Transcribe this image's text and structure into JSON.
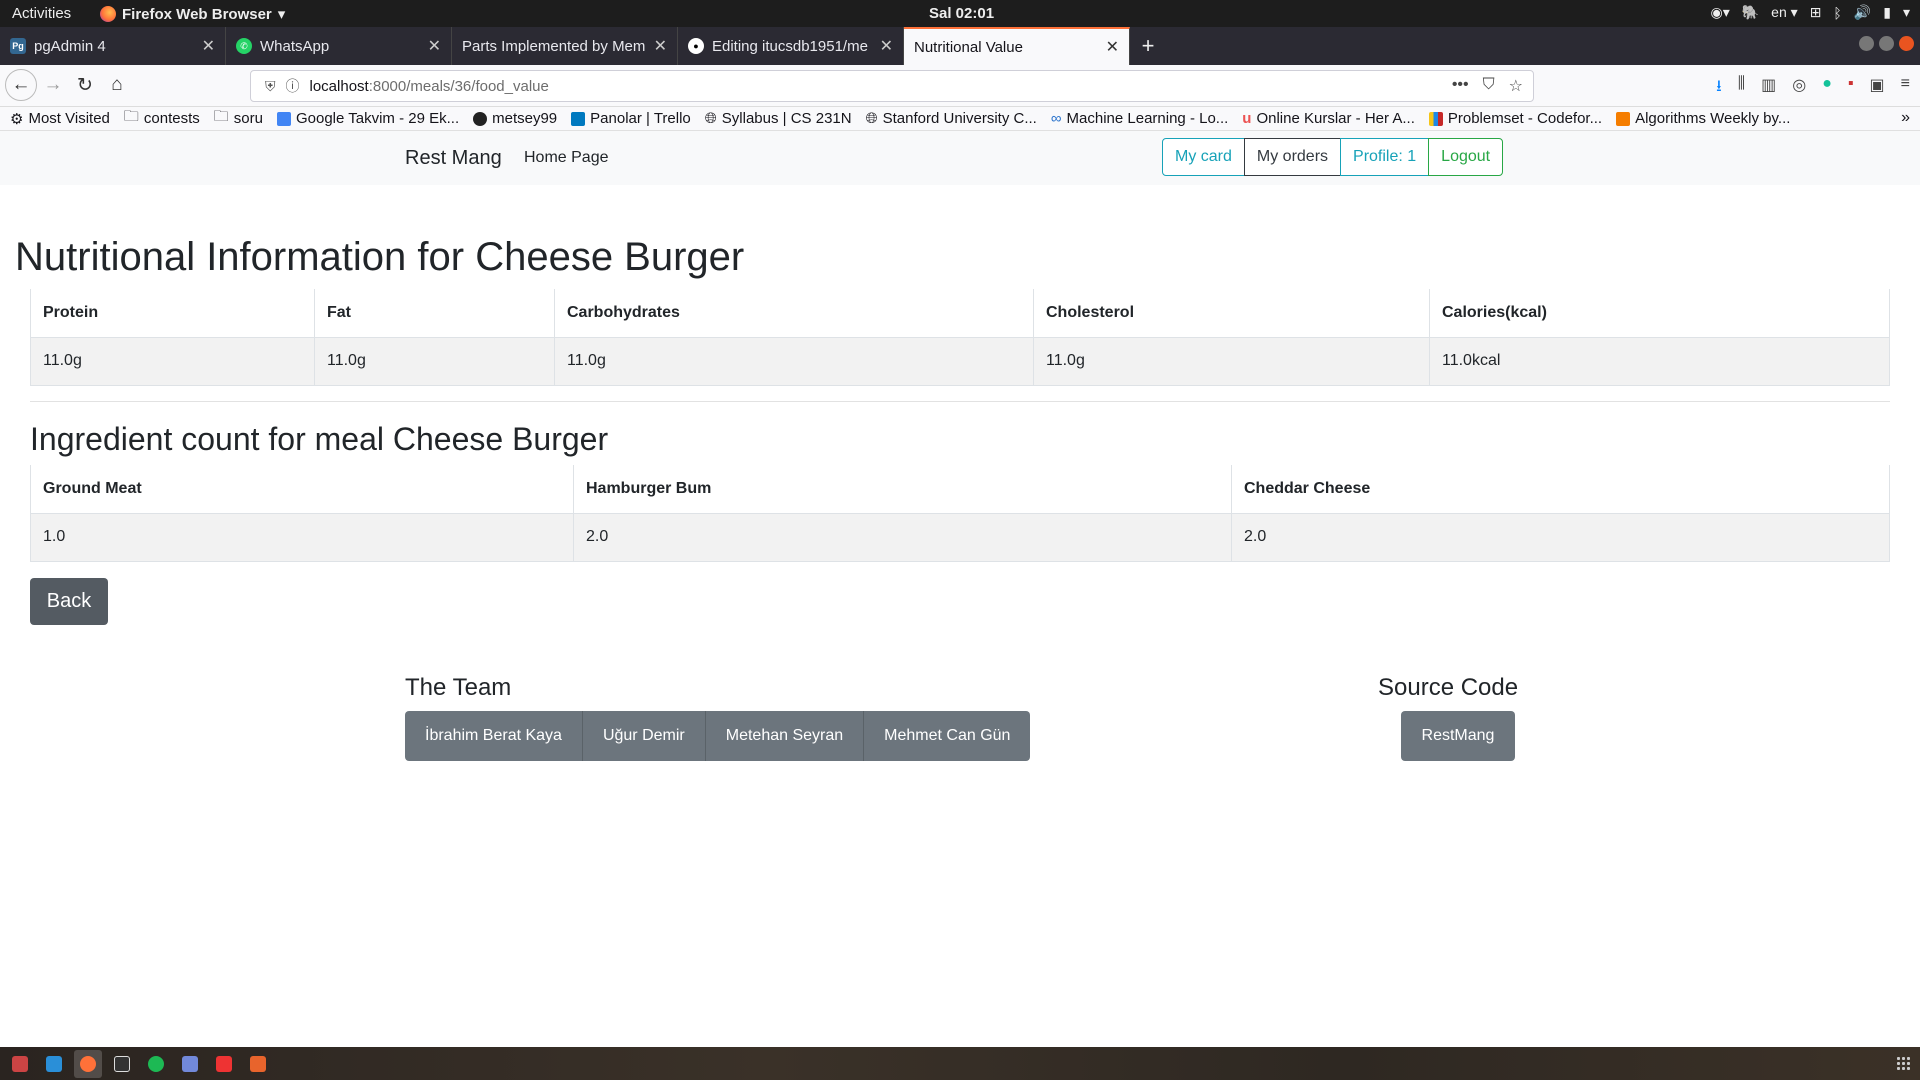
{
  "gnome": {
    "activities": "Activities",
    "app_name": "Firefox Web Browser",
    "clock": "Sal 02:01",
    "lang": "en"
  },
  "tabs": [
    {
      "title": "pgAdmin 4",
      "favicon": "pgadmin-icon",
      "favicon_text": "Pg",
      "color": "#336791"
    },
    {
      "title": "WhatsApp",
      "favicon": "whatsapp-icon",
      "favicon_text": "",
      "color": "#25d366"
    },
    {
      "title": "Parts Implemented by Mem",
      "favicon": "none",
      "favicon_text": "",
      "color": ""
    },
    {
      "title": "Editing itucsdb1951/me",
      "favicon": "github-icon",
      "favicon_text": "",
      "color": "#fff"
    },
    {
      "title": "Nutritional Value",
      "favicon": "none",
      "favicon_text": "",
      "color": "",
      "active": true
    }
  ],
  "url": {
    "host": "localhost",
    "path": ":8000/meals/36/food_value"
  },
  "bookmarks": [
    {
      "label": "Most Visited",
      "icon": "gear-icon",
      "color": "#555"
    },
    {
      "label": "contests",
      "icon": "folder-icon",
      "color": "#777"
    },
    {
      "label": "soru",
      "icon": "folder-icon",
      "color": "#777"
    },
    {
      "label": "Google Takvim - 29 Ek...",
      "icon": "calendar-icon",
      "color": "#4285f4"
    },
    {
      "label": "metsey99",
      "icon": "github-icon",
      "color": "#222"
    },
    {
      "label": "Panolar | Trello",
      "icon": "trello-icon",
      "color": "#0079bf"
    },
    {
      "label": "Syllabus | CS 231N",
      "icon": "globe-icon",
      "color": "#666"
    },
    {
      "label": "Stanford University C...",
      "icon": "globe-icon",
      "color": "#666"
    },
    {
      "label": "Machine Learning - Lo...",
      "icon": "coursera-icon",
      "color": "#2a73cc"
    },
    {
      "label": "Online Kurslar - Her A...",
      "icon": "udemy-icon",
      "color": "#ec5252"
    },
    {
      "label": "Problemset - Codefor...",
      "icon": "codeforces-icon",
      "color": "#f5c518"
    },
    {
      "label": "Algorithms Weekly by...",
      "icon": "blogger-icon",
      "color": "#f57d00"
    }
  ],
  "site": {
    "brand": "Rest Mang",
    "home": "Home Page",
    "nav_buttons": [
      {
        "label": "My card",
        "style": "info"
      },
      {
        "label": "My orders",
        "style": "dark"
      },
      {
        "label": "Profile: 1",
        "style": "info"
      },
      {
        "label": "Logout",
        "style": "success"
      }
    ]
  },
  "nutrition": {
    "title": "Nutritional Information for Cheese Burger",
    "headers": [
      "Protein",
      "Fat",
      "Carbohydrates",
      "Cholesterol",
      "Calories(kcal)"
    ],
    "values": [
      "11.0g",
      "11.0g",
      "11.0g",
      "11.0g",
      "11.0kcal"
    ]
  },
  "ingredients": {
    "title": "Ingredient count for meal Cheese Burger",
    "headers": [
      "Ground Meat",
      "Hamburger Bum",
      "Cheddar Cheese"
    ],
    "values": [
      "1.0",
      "2.0",
      "2.0"
    ]
  },
  "back_label": "Back",
  "footer": {
    "team_title": "The Team",
    "team": [
      "İbrahim Berat Kaya",
      "Uğur Demir",
      "Metehan Seyran",
      "Mehmet Can Gün"
    ],
    "source_title": "Source Code",
    "source_label": "RestMang"
  },
  "taskbar": [
    {
      "icon": "files-icon",
      "color": "#c44"
    },
    {
      "icon": "vscode-icon",
      "color": "#2a8fd8"
    },
    {
      "icon": "firefox-icon",
      "color": "#ff7139",
      "active": true
    },
    {
      "icon": "terminal-icon",
      "color": "#ddd"
    },
    {
      "icon": "spotify-icon",
      "color": "#1db954"
    },
    {
      "icon": "discord-icon",
      "color": "#7289da"
    },
    {
      "icon": "text-editor-icon",
      "color": "#e33"
    },
    {
      "icon": "software-icon",
      "color": "#e8642c"
    }
  ]
}
